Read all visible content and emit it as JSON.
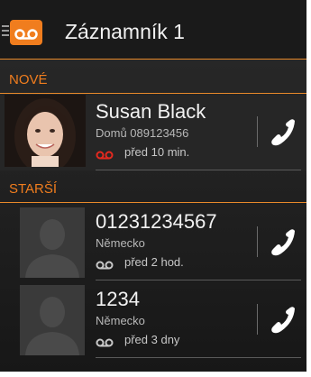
{
  "header": {
    "title": "Záznamník 1",
    "icon": "voicemail-icon",
    "accent": "#f07d1e"
  },
  "sections": {
    "new": "NOVÉ",
    "older": "STARŠÍ"
  },
  "messages": [
    {
      "name": "Susan Black",
      "detail": "Domů 089123456",
      "time": "před 10 min.",
      "unread": true,
      "voicemail_color": "#e4291f",
      "avatar": "photo"
    },
    {
      "name": "01231234567",
      "detail": "Německo",
      "time": "před 2 hod.",
      "unread": false,
      "voicemail_color": "#c8c8c8",
      "avatar": "placeholder"
    },
    {
      "name": "1234",
      "detail": "Německo",
      "time": "před 3 dny",
      "unread": false,
      "voicemail_color": "#c8c8c8",
      "avatar": "placeholder"
    }
  ]
}
